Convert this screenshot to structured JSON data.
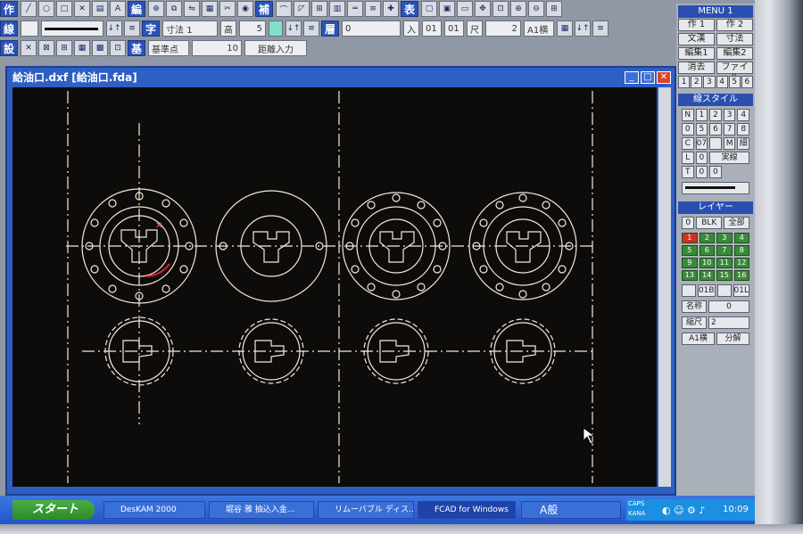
{
  "toolbar": {
    "row1": {
      "tag_create": "作",
      "tag_edit": "編",
      "tag_modify": "補",
      "tag_table": "表",
      "text_icon": "A"
    },
    "row2": {
      "tag_line": "線",
      "tag_char": "字",
      "dim_label": "寸法 1",
      "height_label": "高",
      "height_value": "5",
      "layer_tag": "層",
      "layer_value": "0",
      "input_label": "入",
      "val_a": "01",
      "val_b": "01",
      "scale_label": "尺",
      "scale_value": "2",
      "font_label": "A1横"
    },
    "row3": {
      "tag_setting": "設",
      "tag_base": "基",
      "base_point_label": "基準点",
      "base_point_value": "10",
      "distance_input": "距離入力"
    }
  },
  "window": {
    "title": "給油口.dxf [給油口.fda]",
    "min": "_",
    "max": "□",
    "close": "✕"
  },
  "right_panel": {
    "menu_title": "MENU 1",
    "menu_buttons": [
      "作 1",
      "作 2",
      "文漢",
      "寸法",
      "編集1",
      "編集2",
      "消去",
      "ファイル"
    ],
    "numbers": [
      "1",
      "2",
      "3",
      "4",
      "5",
      "6"
    ],
    "line_style_title": "線スタイル",
    "line_style_rows": [
      [
        "N",
        "1",
        "2",
        "3",
        "4"
      ],
      [
        "0",
        "5",
        "6",
        "7",
        "8"
      ],
      [
        "C",
        "07",
        "",
        "M",
        "細"
      ],
      [
        "L",
        "0",
        "実線",
        "",
        ""
      ],
      [
        "T",
        "0",
        "0",
        "",
        ""
      ]
    ],
    "layer_title": "レイヤー",
    "layer_top": [
      "0",
      "BLK",
      "全部"
    ],
    "layers": [
      "1",
      "2",
      "3",
      "4",
      "5",
      "6",
      "7",
      "8",
      "9",
      "10",
      "11",
      "12",
      "13",
      "14",
      "15",
      "16"
    ],
    "layer_row2": [
      "",
      "01B",
      "",
      "01L"
    ],
    "name_label": "名称",
    "name_value": "0",
    "scale_label": "縮尺",
    "scale_value": "2",
    "font_label": "A1横",
    "split_label": "分解"
  },
  "taskbar": {
    "start": "スタート",
    "items": [
      "DesKAM 2000",
      "堀谷 雅 抽込入金...",
      "リムーバブル ディス...",
      "FCAD for Windows"
    ],
    "ime": "A般",
    "caps": "CAPS",
    "kana": "KANA",
    "clock": "10:09"
  }
}
